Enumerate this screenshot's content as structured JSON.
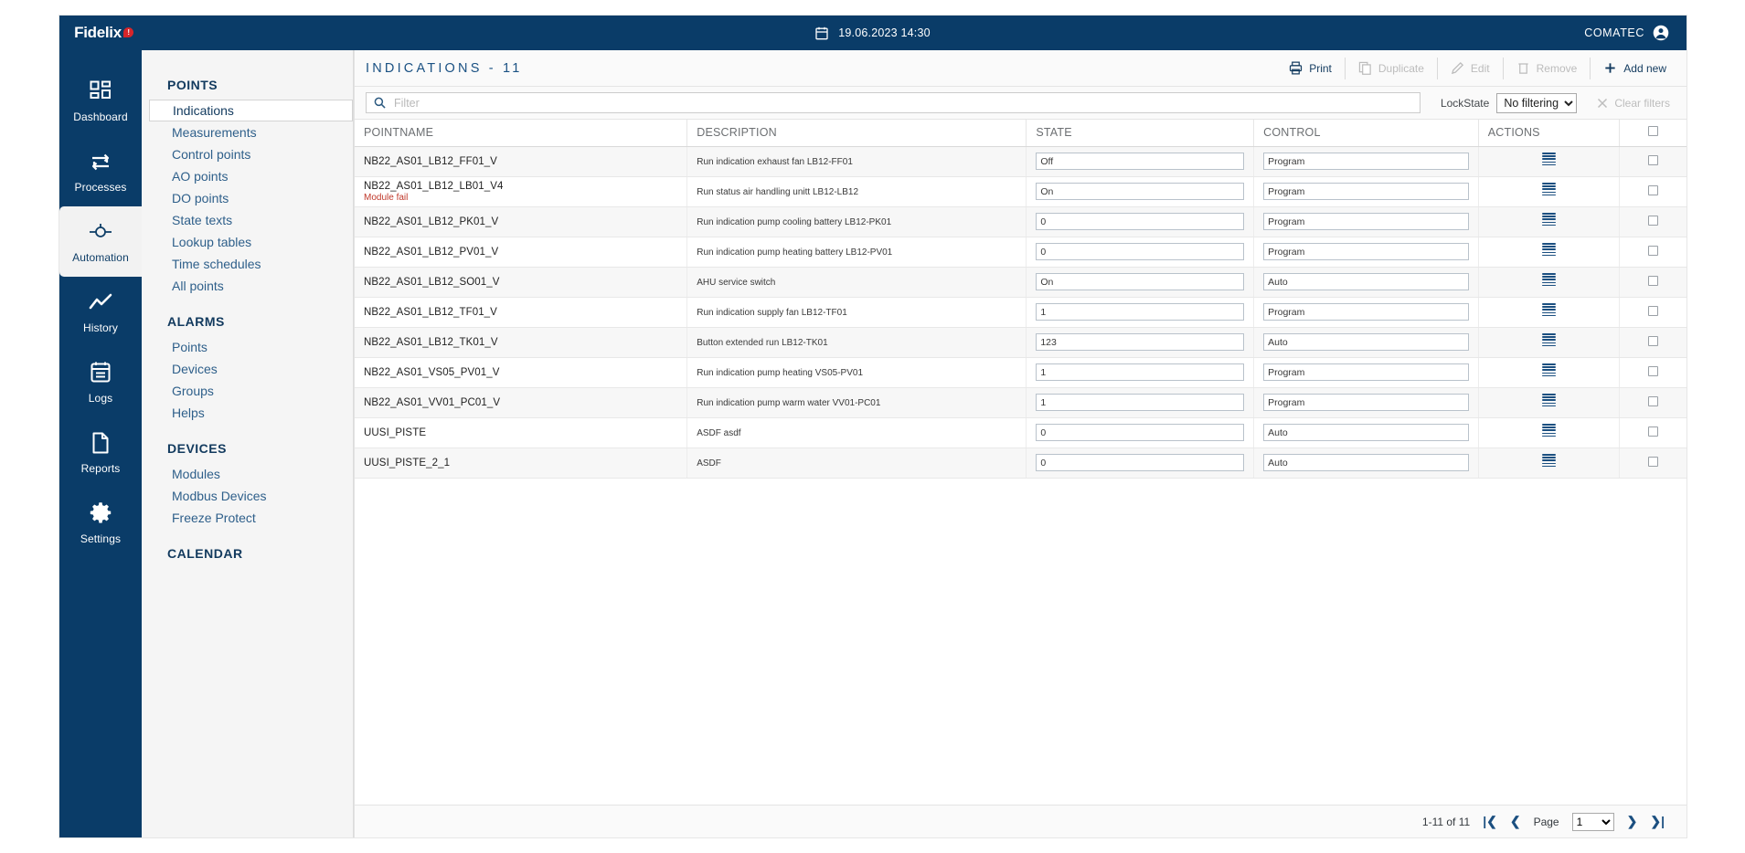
{
  "topbar": {
    "brand": "Fidelix",
    "brand_badge": "!",
    "datetime": "19.06.2023  14:30",
    "user": "COMATEC"
  },
  "rail": {
    "items": [
      {
        "label": "Dashboard",
        "icon": "dashboard-icon",
        "active": false
      },
      {
        "label": "Processes",
        "icon": "processes-icon",
        "active": false
      },
      {
        "label": "Automation",
        "icon": "automation-icon",
        "active": true
      },
      {
        "label": "History",
        "icon": "history-icon",
        "active": false
      },
      {
        "label": "Logs",
        "icon": "logs-icon",
        "active": false
      },
      {
        "label": "Reports",
        "icon": "reports-icon",
        "active": false
      },
      {
        "label": "Settings",
        "icon": "settings-icon",
        "active": false
      }
    ]
  },
  "subnav": {
    "sections": [
      {
        "title": "POINTS",
        "items": [
          "Indications",
          "Measurements",
          "Control points",
          "AO points",
          "DO points",
          "State texts",
          "Lookup tables",
          "Time schedules",
          "All points"
        ],
        "active": "Indications"
      },
      {
        "title": "ALARMS",
        "items": [
          "Points",
          "Devices",
          "Groups",
          "Helps"
        ],
        "active": ""
      },
      {
        "title": "DEVICES",
        "items": [
          "Modules",
          "Modbus Devices",
          "Freeze Protect"
        ],
        "active": ""
      },
      {
        "title": "CALENDAR",
        "items": [],
        "active": ""
      }
    ]
  },
  "main": {
    "title": "INDICATIONS - 11",
    "toolbar": [
      {
        "label": "Print",
        "icon": "print-icon",
        "disabled": false
      },
      {
        "label": "Duplicate",
        "icon": "duplicate-icon",
        "disabled": true
      },
      {
        "label": "Edit",
        "icon": "pencil-icon",
        "disabled": true
      },
      {
        "label": "Remove",
        "icon": "trash-icon",
        "disabled": true
      },
      {
        "label": "Add new",
        "icon": "plus-icon",
        "disabled": false
      }
    ],
    "filter": {
      "value": "",
      "placeholder": "Filter"
    },
    "lockstate": {
      "label": "LockState",
      "value": "No filtering",
      "options": [
        "No filtering"
      ]
    },
    "clear_filters": "Clear filters"
  },
  "table": {
    "columns": [
      "POINTNAME",
      "DESCRIPTION",
      "STATE",
      "CONTROL",
      "ACTIONS"
    ],
    "rows": [
      {
        "pointname": "NB22_AS01_LB12_FF01_V",
        "status": "",
        "description": "Run indication exhaust fan LB12-FF01",
        "state": "Off",
        "control": "Program"
      },
      {
        "pointname": "NB22_AS01_LB12_LB01_V4",
        "status": "Module fail",
        "description": "Run status air handling unitt LB12-LB12",
        "state": "On",
        "control": "Program"
      },
      {
        "pointname": "NB22_AS01_LB12_PK01_V",
        "status": "",
        "description": "Run indication pump cooling battery LB12-PK01",
        "state": "0",
        "control": "Program"
      },
      {
        "pointname": "NB22_AS01_LB12_PV01_V",
        "status": "",
        "description": "Run indication pump heating battery LB12-PV01",
        "state": "0",
        "control": "Program"
      },
      {
        "pointname": "NB22_AS01_LB12_SO01_V",
        "status": "",
        "description": "AHU service switch",
        "state": "On",
        "control": "Auto"
      },
      {
        "pointname": "NB22_AS01_LB12_TF01_V",
        "status": "",
        "description": "Run indication supply fan LB12-TF01",
        "state": "1",
        "control": "Program"
      },
      {
        "pointname": "NB22_AS01_LB12_TK01_V",
        "status": "",
        "description": "Button extended run LB12-TK01",
        "state": "123",
        "control": "Auto"
      },
      {
        "pointname": "NB22_AS01_VS05_PV01_V",
        "status": "",
        "description": "Run indication pump heating VS05-PV01",
        "state": "1",
        "control": "Program"
      },
      {
        "pointname": "NB22_AS01_VV01_PC01_V",
        "status": "",
        "description": "Run indication pump warm water VV01-PC01",
        "state": "1",
        "control": "Program"
      },
      {
        "pointname": "UUSI_PISTE",
        "status": "",
        "description": "ASDF asdf",
        "state": "0",
        "control": "Auto"
      },
      {
        "pointname": "UUSI_PISTE_2_1",
        "status": "",
        "description": "ASDF",
        "state": "0",
        "control": "Auto"
      }
    ]
  },
  "pager": {
    "range": "1-11 of 11",
    "page_label": "Page",
    "page_value": "1",
    "page_options": [
      "1"
    ]
  },
  "colors": {
    "navy": "#0a3c68",
    "accent": "#1b4f80",
    "alert_red": "#c0392b",
    "badge_red": "#d6252a"
  }
}
